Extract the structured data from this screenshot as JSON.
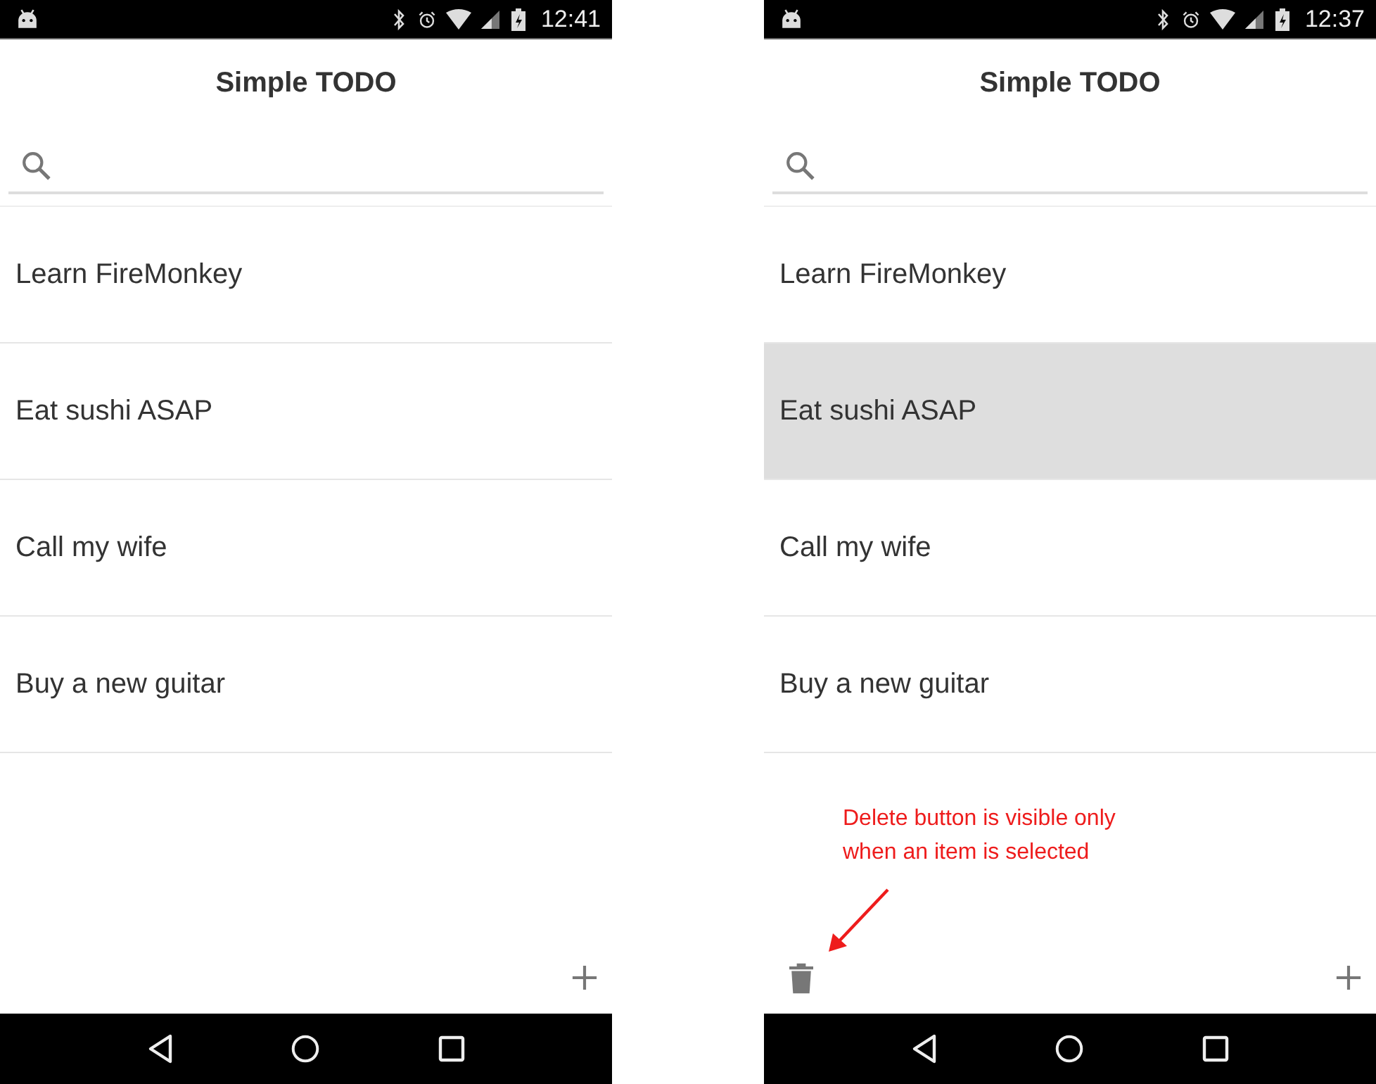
{
  "phones": [
    {
      "status_bar": {
        "time": "12:41"
      },
      "title": "Simple TODO",
      "delete_visible": false,
      "items": [
        {
          "label": "Learn FireMonkey",
          "selected": false
        },
        {
          "label": "Eat sushi ASAP",
          "selected": false
        },
        {
          "label": "Call my wife",
          "selected": false
        },
        {
          "label": "Buy a new guitar",
          "selected": false
        }
      ]
    },
    {
      "status_bar": {
        "time": "12:37"
      },
      "title": "Simple TODO",
      "delete_visible": true,
      "items": [
        {
          "label": "Learn FireMonkey",
          "selected": false
        },
        {
          "label": "Eat sushi ASAP",
          "selected": true
        },
        {
          "label": "Call my wife",
          "selected": false
        },
        {
          "label": "Buy a new guitar",
          "selected": false
        }
      ],
      "annotation": "Delete button is visible only when an item is selected"
    }
  ]
}
